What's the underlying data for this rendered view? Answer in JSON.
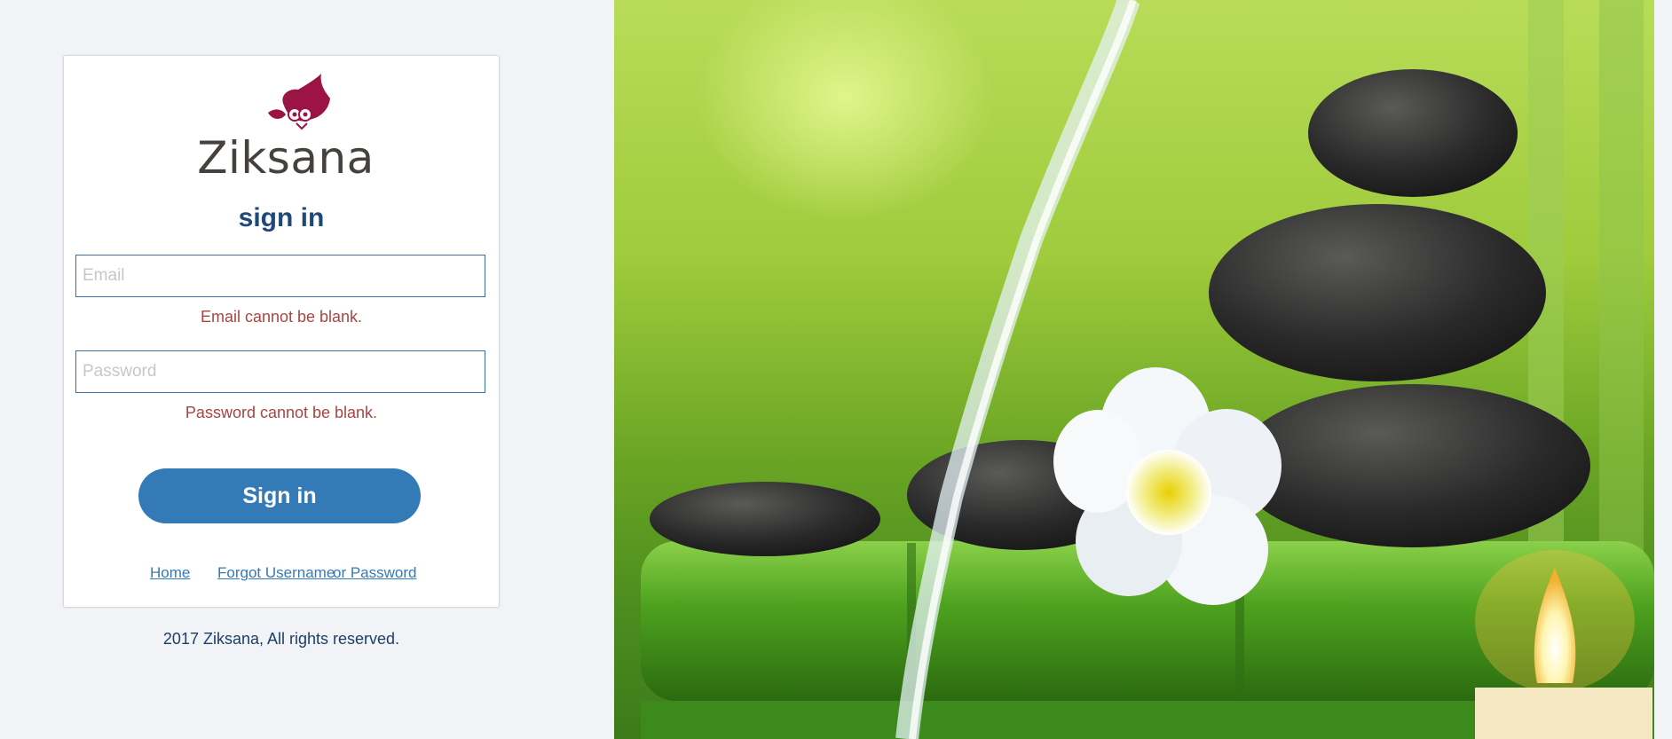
{
  "brand": {
    "name": "Ziksana",
    "logo_icon": "owl-icon",
    "logo_color": "#9b1443"
  },
  "form": {
    "title": "sign in",
    "email": {
      "placeholder": "Email",
      "value": "",
      "error": "Email cannot be blank."
    },
    "password": {
      "placeholder": "Password",
      "value": "",
      "error": "Password cannot be blank."
    },
    "submit_label": "Sign in"
  },
  "links": {
    "home": "Home",
    "forgot_username": "Forgot Username",
    "or_password": "or Password"
  },
  "footer": {
    "copyright": "2017 Ziksana, All rights reserved."
  },
  "colors": {
    "accent": "#337ab7",
    "error": "#a94442",
    "title": "#1e4878"
  },
  "hero": {
    "icon": "spa-stones-water-flower-image"
  }
}
